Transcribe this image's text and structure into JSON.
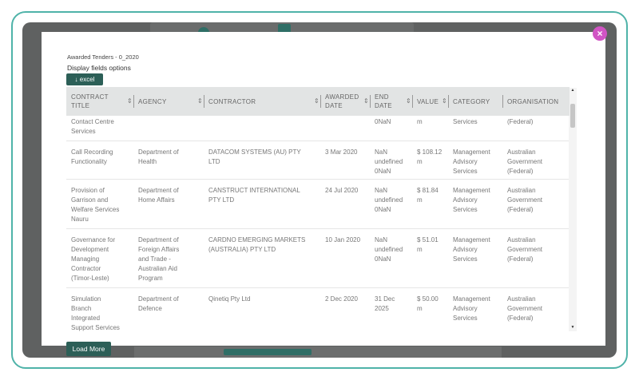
{
  "modal": {
    "title": "Awarded Tenders - 0_2020",
    "display_fields_label": "Display fields options",
    "excel_button": "excel",
    "close_glyph": "×",
    "load_more_label": "Load More"
  },
  "icons": {
    "download": "download-icon",
    "sort": "sort-icon",
    "close": "close-icon"
  },
  "colors": {
    "accent": "#2c5f57",
    "close": "#d154c4",
    "frame": "#4fb3a9"
  },
  "table": {
    "columns": [
      {
        "line1": "CONTRACT",
        "line2": "TITLE"
      },
      {
        "line1": "AGENCY",
        "line2": ""
      },
      {
        "line1": "CONTRACTOR",
        "line2": ""
      },
      {
        "line1": "AWARDED",
        "line2": "DATE"
      },
      {
        "line1": "END",
        "line2": "DATE"
      },
      {
        "line1": "VALUE",
        "line2": ""
      },
      {
        "line1": "CATEGORY",
        "line2": ""
      },
      {
        "line1": "ORGANISATION",
        "line2": ""
      }
    ],
    "partial_row": {
      "title": [
        "Contact Centre",
        "Services"
      ],
      "end_date": [
        "0NaN"
      ],
      "value": [
        "m"
      ],
      "category": [
        "Services"
      ],
      "organisation": [
        "(Federal)"
      ]
    },
    "rows": [
      {
        "title": [
          "Call Recording",
          "Functionality"
        ],
        "agency": [
          "Department of",
          "Health"
        ],
        "contractor": [
          "DATACOM SYSTEMS (AU) PTY",
          "LTD"
        ],
        "awarded": "3 Mar 2020",
        "end_date": [
          "NaN",
          "undefined",
          "0NaN"
        ],
        "value": [
          "$ 108.12",
          "m"
        ],
        "category": [
          "Management",
          "Advisory",
          "Services"
        ],
        "organisation": [
          "Australian",
          "Government",
          "(Federal)"
        ]
      },
      {
        "title": [
          "Provision of",
          "Garrison and",
          "Welfare Services",
          "Nauru"
        ],
        "agency": [
          "Department of",
          "Home Affairs"
        ],
        "contractor": [
          "CANSTRUCT INTERNATIONAL",
          "PTY LTD"
        ],
        "awarded": "24 Jul 2020",
        "end_date": [
          "NaN",
          "undefined",
          "0NaN"
        ],
        "value": [
          "$ 81.84",
          "m"
        ],
        "category": [
          "Management",
          "Advisory",
          "Services"
        ],
        "organisation": [
          "Australian",
          "Government",
          "(Federal)"
        ]
      },
      {
        "title": [
          "Governance for",
          "Development",
          "Managing",
          "Contractor",
          "(Timor-Leste)"
        ],
        "agency": [
          "Department of",
          "Foreign Affairs",
          "and Trade -",
          "Australian Aid",
          "Program"
        ],
        "contractor": [
          "CARDNO EMERGING MARKETS",
          "(AUSTRALIA) PTY LTD"
        ],
        "awarded": "10 Jan 2020",
        "end_date": [
          "NaN",
          "undefined",
          "0NaN"
        ],
        "value": [
          "$ 51.01",
          "m"
        ],
        "category": [
          "Management",
          "Advisory",
          "Services"
        ],
        "organisation": [
          "Australian",
          "Government",
          "(Federal)"
        ]
      },
      {
        "title": [
          "Simulation",
          "Branch",
          "Integrated",
          "Support Services"
        ],
        "agency": [
          "Department of",
          "Defence"
        ],
        "contractor": [
          "Qinetiq Pty Ltd"
        ],
        "awarded": "2 Dec 2020",
        "end_date": [
          "31 Dec",
          "2025"
        ],
        "value": [
          "$ 50.00",
          "m"
        ],
        "category": [
          "Management",
          "Advisory",
          "Services"
        ],
        "organisation": [
          "Australian",
          "Government",
          "(Federal)"
        ]
      }
    ]
  }
}
